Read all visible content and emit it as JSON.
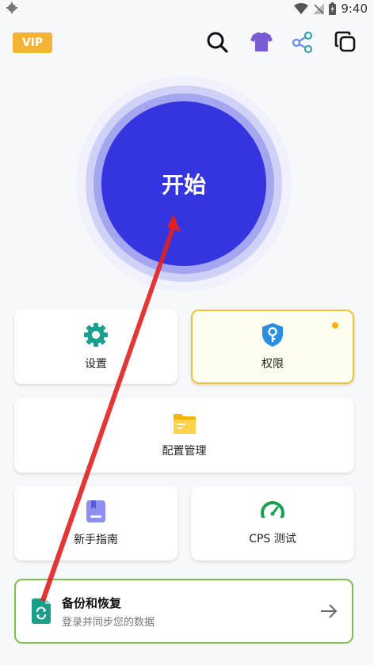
{
  "status_bar": {
    "time": "9:40"
  },
  "header": {
    "vip_label": "VIP"
  },
  "main": {
    "start_label": "开始"
  },
  "grid": {
    "settings_label": "设置",
    "permissions_label": "权限",
    "config_label": "配置管理",
    "guide_label": "新手指南",
    "cps_label": "CPS 测试"
  },
  "backup": {
    "title": "备份和恢复",
    "subtitle": "登录并同步您的数据"
  },
  "colors": {
    "accent": "#3434e0",
    "vip": "#f3b335",
    "teal": "#1aa08c",
    "highlight_border": "#f2c33a",
    "backup_border": "#7cc04e",
    "annotation_arrow": "#e02020"
  }
}
